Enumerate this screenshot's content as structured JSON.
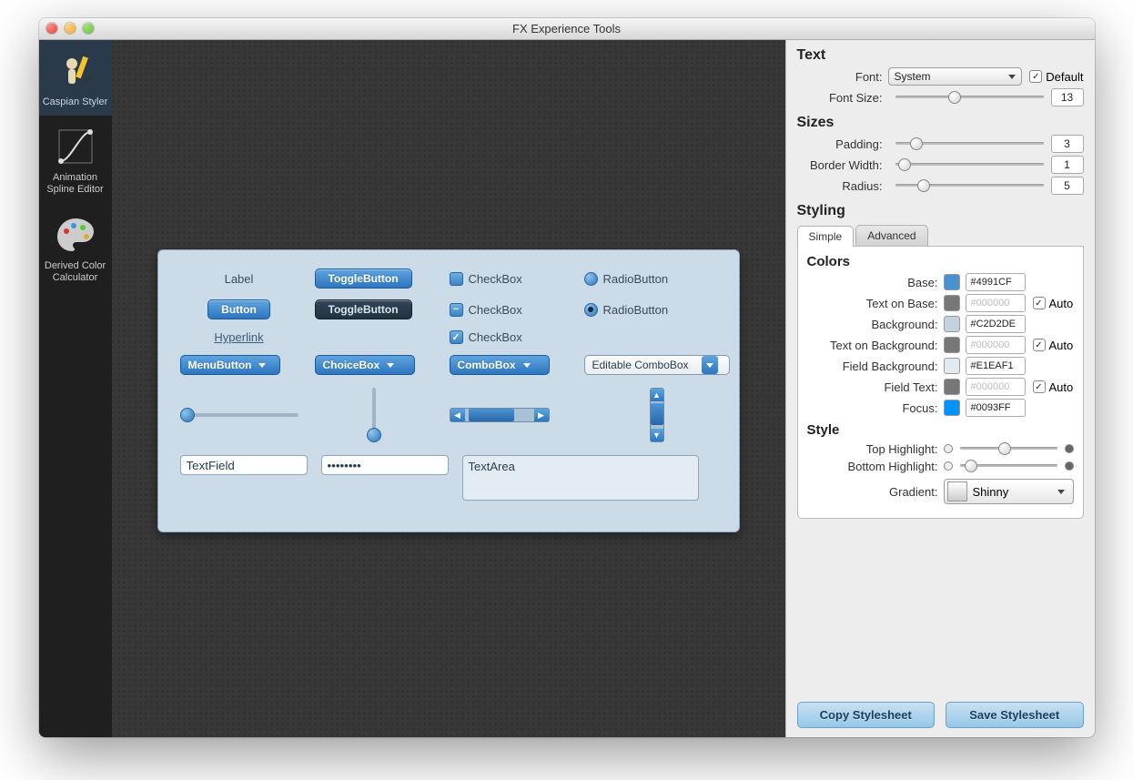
{
  "window_title": "FX Experience Tools",
  "sidebar": {
    "items": [
      {
        "label": "Caspian Styler",
        "active": true
      },
      {
        "label": "Animation Spline Editor",
        "active": false
      },
      {
        "label": "Derived Color Calculator",
        "active": false
      }
    ]
  },
  "preview": {
    "label": "Label",
    "button": "Button",
    "hyperlink": "Hyperlink",
    "toggle1": "ToggleButton",
    "toggle2": "ToggleButton",
    "checkbox1": "CheckBox",
    "checkbox2": "CheckBox",
    "checkbox3": "CheckBox",
    "radio1": "RadioButton",
    "radio2": "RadioButton",
    "menubutton": "MenuButton",
    "choicebox": "ChoiceBox",
    "combobox": "ComboBox",
    "editable_combobox": "Editable ComboBox",
    "textfield": "TextField",
    "password_masked": "••••••••",
    "textarea": "TextArea"
  },
  "right": {
    "text": {
      "heading": "Text",
      "font_label": "Font:",
      "font_value": "System",
      "default_label": "Default",
      "default_checked": true,
      "fontsize_label": "Font Size:",
      "fontsize_value": "13"
    },
    "sizes": {
      "heading": "Sizes",
      "padding_label": "Padding:",
      "padding_value": "3",
      "borderwidth_label": "Border Width:",
      "borderwidth_value": "1",
      "radius_label": "Radius:",
      "radius_value": "5"
    },
    "styling": {
      "heading": "Styling",
      "tab_simple": "Simple",
      "tab_advanced": "Advanced",
      "colors_heading": "Colors",
      "rows": {
        "base": {
          "label": "Base:",
          "value": "#4991CF",
          "swatch": "#4991CF",
          "auto": null
        },
        "text_on_base": {
          "label": "Text on Base:",
          "value": "#000000",
          "swatch": "#777777",
          "auto": true,
          "disabled": true
        },
        "background": {
          "label": "Background:",
          "value": "#C2D2DE",
          "swatch": "#C2D2DE",
          "auto": null
        },
        "text_on_background": {
          "label": "Text on Background:",
          "value": "#000000",
          "swatch": "#777777",
          "auto": true,
          "disabled": true
        },
        "field_background": {
          "label": "Field Background:",
          "value": "#E1EAF1",
          "swatch": "#E1EAF1",
          "auto": null
        },
        "field_text": {
          "label": "Field Text:",
          "value": "#000000",
          "swatch": "#777777",
          "auto": true,
          "disabled": true
        },
        "focus": {
          "label": "Focus:",
          "value": "#0093FF",
          "swatch": "#0093FF",
          "auto": null
        }
      },
      "style_heading": "Style",
      "top_hl_label": "Top Highlight:",
      "bottom_hl_label": "Bottom Highlight:",
      "gradient_label": "Gradient:",
      "gradient_value": "Shinny",
      "auto_label": "Auto"
    },
    "buttons": {
      "copy": "Copy Stylesheet",
      "save": "Save Stylesheet"
    }
  }
}
